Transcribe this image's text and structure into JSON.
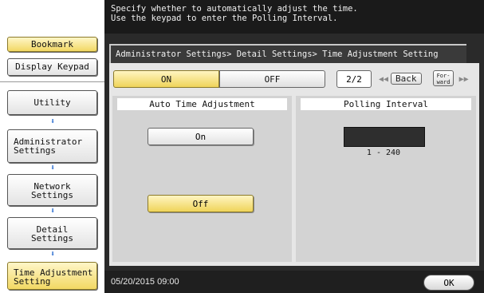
{
  "instruction": {
    "line1": "Specify whether to automatically adjust the time.",
    "line2": "Use the keypad to enter the Polling Interval."
  },
  "sidebar": {
    "bookmark": "Bookmark",
    "display_keypad": "Display Keypad",
    "utility": "Utility",
    "administrator_settings": [
      "Administrator",
      "Settings"
    ],
    "network_settings": [
      "Network",
      "Settings"
    ],
    "detail_settings": [
      "Detail",
      "Settings"
    ],
    "time_adjustment_setting": [
      "Time Adjustment",
      "Setting"
    ]
  },
  "breadcrumb": "Administrator Settings> Detail Settings> Time Adjustment Setting",
  "toggle": {
    "on": "ON",
    "off": "OFF",
    "selected": "ON"
  },
  "pagination": {
    "page": "2/2",
    "back": "Back",
    "forward_l1": "For-",
    "forward_l2": "ward"
  },
  "auto_time": {
    "title": "Auto Time Adjustment",
    "on_label": "On",
    "off_label": "Off",
    "selected": "Off"
  },
  "polling": {
    "title": "Polling Interval",
    "value": "",
    "range": "1  -  240"
  },
  "status": {
    "datetime": "05/20/2015  09:00"
  },
  "ok_label": "OK",
  "colors": {
    "accent_yellow": "#f2d863",
    "dark_bg": "#2a2a2a",
    "arrow_blue": "#2d6fd0"
  }
}
